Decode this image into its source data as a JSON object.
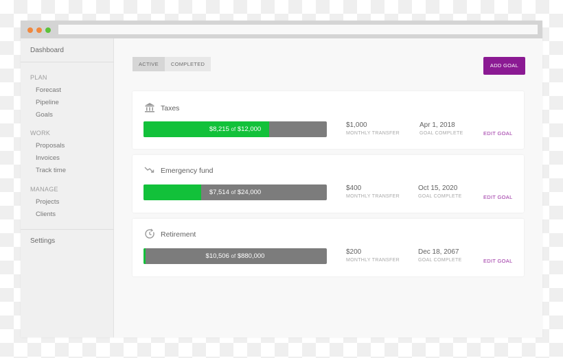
{
  "window": {
    "controls": [
      "close",
      "minimize",
      "maximize"
    ],
    "address_bar": ""
  },
  "sidebar": {
    "dashboard": "Dashboard",
    "sections": [
      {
        "heading": "PLAN",
        "items": [
          "Forecast",
          "Pipeline",
          "Goals"
        ]
      },
      {
        "heading": "WORK",
        "items": [
          "Proposals",
          "Invoices",
          "Track time"
        ]
      },
      {
        "heading": "MANAGE",
        "items": [
          "Projects",
          "Clients"
        ]
      }
    ],
    "settings": "Settings"
  },
  "main": {
    "tabs": [
      {
        "label": "ACTIVE",
        "active": true
      },
      {
        "label": "COMPLETED",
        "active": false
      }
    ],
    "add_goal_label": "ADD GOAL",
    "colors": {
      "accent": "#8b1a93",
      "progress_fill": "#12c13a",
      "progress_track": "#7c7c7c",
      "edit_link": "#9a2da2"
    },
    "goals": [
      {
        "icon": "bank-icon",
        "title": "Taxes",
        "saved": "$8,215",
        "of": "of",
        "target": "$12,000",
        "progress_fraction": 0.6846,
        "monthly_transfer": "$1,000",
        "monthly_transfer_label": "MONTHLY TRANSFER",
        "complete_date": "Apr 1, 2018",
        "complete_label": "GOAL COMPLETE",
        "edit_label": "EDIT GOAL"
      },
      {
        "icon": "trend-down-icon",
        "title": "Emergency fund",
        "saved": "$7,514",
        "of": "of",
        "target": "$24,000",
        "progress_fraction": 0.3131,
        "monthly_transfer": "$400",
        "monthly_transfer_label": "MONTHLY TRANSFER",
        "complete_date": "Oct 15, 2020",
        "complete_label": "GOAL COMPLETE",
        "edit_label": "EDIT GOAL"
      },
      {
        "icon": "history-clock-icon",
        "title": "Retirement",
        "saved": "$10,506",
        "of": "of",
        "target": "$880,000",
        "progress_fraction": 0.0119,
        "monthly_transfer": "$200",
        "monthly_transfer_label": "MONTHLY TRANSFER",
        "complete_date": "Dec 18, 2067",
        "complete_label": "GOAL COMPLETE",
        "edit_label": "EDIT GOAL"
      }
    ]
  }
}
